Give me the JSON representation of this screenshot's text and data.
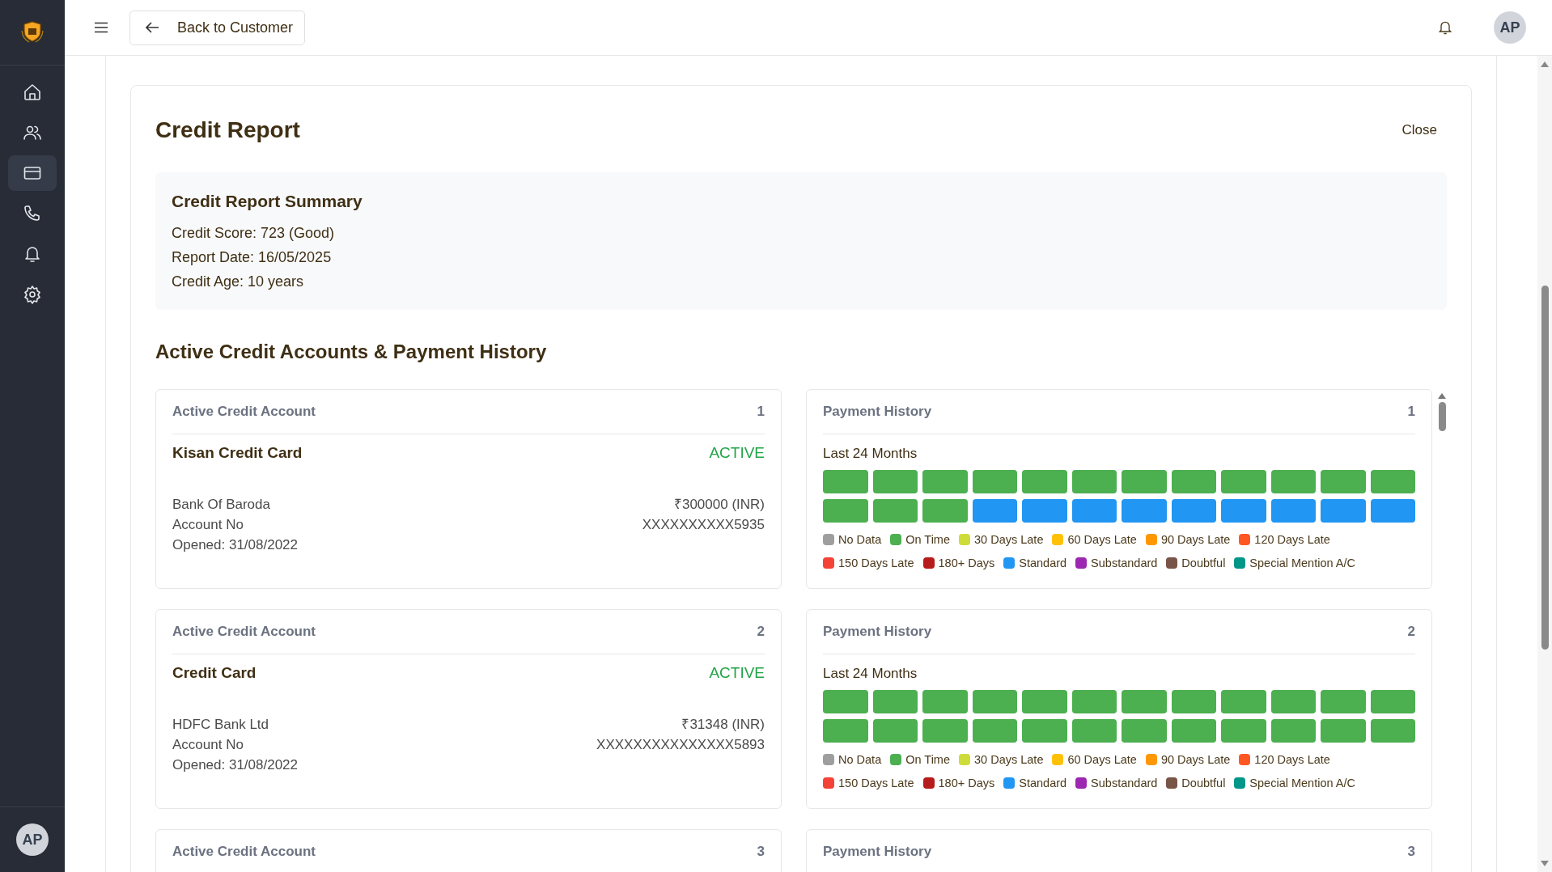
{
  "sidebar": {
    "items": [
      {
        "selected": false
      },
      {
        "selected": false
      },
      {
        "selected": true
      },
      {
        "selected": false
      },
      {
        "selected": false
      },
      {
        "selected": false
      }
    ],
    "avatar": "AP"
  },
  "header": {
    "back_button": "Back to Customer",
    "avatar": "AP"
  },
  "report": {
    "title": "Credit Report",
    "close": "Close",
    "summary": {
      "title": "Credit Report Summary",
      "lines": [
        "Credit Score: 723 (Good)",
        "Report Date: 16/05/2025",
        "Credit Age: 10 years"
      ]
    },
    "section_title": "Active Credit Accounts & Payment History",
    "rows": [
      {
        "account": {
          "label": "Active Credit Account",
          "number": "1",
          "name": "Kisan Credit Card",
          "status": "ACTIVE",
          "bank": "Bank Of Baroda",
          "amount": "₹300000 (INR)",
          "account_label": "Account No",
          "account_no": "XXXXXXXXXX5935",
          "opened": "Opened: 31/08/2022"
        },
        "history": {
          "label": "Payment History",
          "number": "1",
          "period": "Last 24 Months",
          "months": [
            {
              "color": "#4caf50"
            },
            {
              "color": "#4caf50"
            },
            {
              "color": "#4caf50"
            },
            {
              "color": "#4caf50"
            },
            {
              "color": "#4caf50"
            },
            {
              "color": "#4caf50"
            },
            {
              "color": "#4caf50"
            },
            {
              "color": "#4caf50"
            },
            {
              "color": "#4caf50"
            },
            {
              "color": "#4caf50"
            },
            {
              "color": "#4caf50"
            },
            {
              "color": "#4caf50"
            },
            {
              "color": "#4caf50"
            },
            {
              "color": "#4caf50"
            },
            {
              "color": "#4caf50"
            },
            {
              "color": "#2196f3"
            },
            {
              "color": "#2196f3"
            },
            {
              "color": "#2196f3"
            },
            {
              "color": "#2196f3"
            },
            {
              "color": "#2196f3"
            },
            {
              "color": "#2196f3"
            },
            {
              "color": "#2196f3"
            },
            {
              "color": "#2196f3"
            },
            {
              "color": "#2196f3"
            }
          ],
          "legend": [
            {
              "label": "No Data",
              "color": "#9e9e9e"
            },
            {
              "label": "On Time",
              "color": "#4caf50"
            },
            {
              "label": "30 Days Late",
              "color": "#cddc39"
            },
            {
              "label": "60 Days Late",
              "color": "#ffc107"
            },
            {
              "label": "90 Days Late",
              "color": "#ff9800"
            },
            {
              "label": "120 Days Late",
              "color": "#ff5722"
            },
            {
              "label": "150 Days Late",
              "color": "#f44336"
            },
            {
              "label": "180+ Days",
              "color": "#b71c1c"
            },
            {
              "label": "Standard",
              "color": "#2196f3"
            },
            {
              "label": "Substandard",
              "color": "#9c27b0"
            },
            {
              "label": "Doubtful",
              "color": "#795548"
            },
            {
              "label": "Special Mention A/C",
              "color": "#009688"
            }
          ]
        }
      },
      {
        "account": {
          "label": "Active Credit Account",
          "number": "2",
          "name": "Credit Card",
          "status": "ACTIVE",
          "bank": "HDFC Bank Ltd",
          "amount": "₹31348 (INR)",
          "account_label": "Account No",
          "account_no": "XXXXXXXXXXXXXXX5893",
          "opened": "Opened: 31/08/2022"
        },
        "history": {
          "label": "Payment History",
          "number": "2",
          "period": "Last 24 Months",
          "months": [
            {
              "color": "#4caf50"
            },
            {
              "color": "#4caf50"
            },
            {
              "color": "#4caf50"
            },
            {
              "color": "#4caf50"
            },
            {
              "color": "#4caf50"
            },
            {
              "color": "#4caf50"
            },
            {
              "color": "#4caf50"
            },
            {
              "color": "#4caf50"
            },
            {
              "color": "#4caf50"
            },
            {
              "color": "#4caf50"
            },
            {
              "color": "#4caf50"
            },
            {
              "color": "#4caf50"
            },
            {
              "color": "#4caf50"
            },
            {
              "color": "#4caf50"
            },
            {
              "color": "#4caf50"
            },
            {
              "color": "#4caf50"
            },
            {
              "color": "#4caf50"
            },
            {
              "color": "#4caf50"
            },
            {
              "color": "#4caf50"
            },
            {
              "color": "#4caf50"
            },
            {
              "color": "#4caf50"
            },
            {
              "color": "#4caf50"
            },
            {
              "color": "#4caf50"
            },
            {
              "color": "#4caf50"
            }
          ],
          "legend": [
            {
              "label": "No Data",
              "color": "#9e9e9e"
            },
            {
              "label": "On Time",
              "color": "#4caf50"
            },
            {
              "label": "30 Days Late",
              "color": "#cddc39"
            },
            {
              "label": "60 Days Late",
              "color": "#ffc107"
            },
            {
              "label": "90 Days Late",
              "color": "#ff9800"
            },
            {
              "label": "120 Days Late",
              "color": "#ff5722"
            },
            {
              "label": "150 Days Late",
              "color": "#f44336"
            },
            {
              "label": "180+ Days",
              "color": "#b71c1c"
            },
            {
              "label": "Standard",
              "color": "#2196f3"
            },
            {
              "label": "Substandard",
              "color": "#9c27b0"
            },
            {
              "label": "Doubtful",
              "color": "#795548"
            },
            {
              "label": "Special Mention A/C",
              "color": "#009688"
            }
          ]
        }
      },
      {
        "account": {
          "label": "Active Credit Account",
          "number": "3"
        },
        "history": {
          "label": "Payment History",
          "number": "3"
        }
      }
    ]
  }
}
